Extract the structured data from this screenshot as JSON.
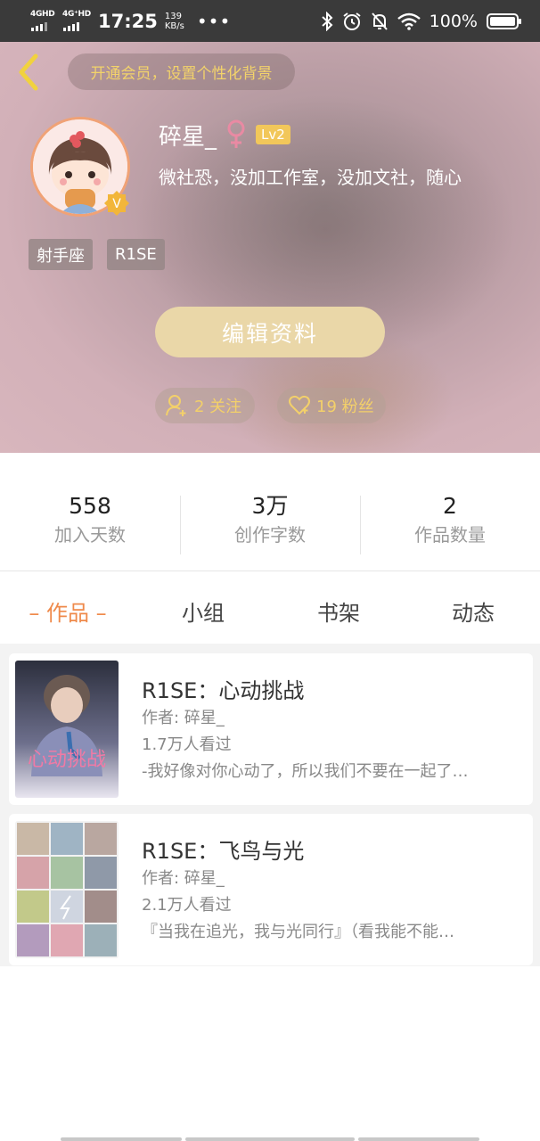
{
  "status_bar": {
    "net1": "4GHD",
    "net2": "4G⁺HD",
    "time": "17:25",
    "speed_value": "139",
    "speed_unit": "KB/s",
    "dots": "•••",
    "battery": "100%",
    "icons": [
      "bluetooth-icon",
      "alarm-icon",
      "mute-icon",
      "wifi-icon",
      "battery-icon"
    ]
  },
  "header": {
    "vip_banner": "开通会员，设置个性化背景",
    "nickname": "碎星_",
    "level": "Lv2",
    "bio": "微社恐，没加工作室，没加文社，随心",
    "tags": [
      "射手座",
      "R1SE"
    ],
    "edit_button": "编辑资料",
    "following": "2 关注",
    "followers": "19 粉丝",
    "accent_color": "#f3d36a"
  },
  "stats": [
    {
      "value": "558",
      "label": "加入天数"
    },
    {
      "value": "3万",
      "label": "创作字数"
    },
    {
      "value": "2",
      "label": "作品数量"
    }
  ],
  "tabs": [
    "– 作品 –",
    "小组",
    "书架",
    "动态"
  ],
  "active_tab_color": "#ef8a4b",
  "works": [
    {
      "title": "R1SE：心动挑战",
      "author": "作者: 碎星_",
      "views": "1.7万人看过",
      "desc": "-我好像对你心动了，所以我们不要在一起了…",
      "cover_text": "心动挑战"
    },
    {
      "title": "R1SE：飞鸟与光",
      "author": "作者: 碎星_",
      "views": "2.1万人看过",
      "desc": "『当我在追光，我与光同行』（看我能不能…"
    }
  ]
}
